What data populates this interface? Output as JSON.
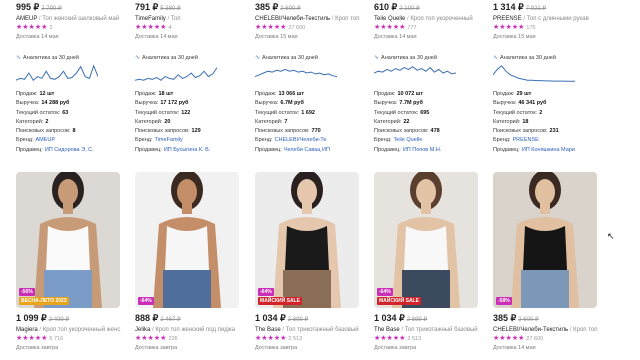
{
  "top_cards": [
    {
      "price": "995 ₽",
      "old_price": "2 790 ₽",
      "brand": "AMEUP",
      "desc": "Топ женский шелковый май",
      "stars": "★★★★★",
      "count": "2",
      "delivery": "Доставка 14 мая",
      "analytics": "Аналитика за 30 дней",
      "spark": [
        0.1,
        0.2,
        0.15,
        0.5,
        0.1,
        0.3,
        0.2,
        0.6,
        0.2,
        0.15,
        0.3,
        0.6,
        0.2,
        0.25,
        0.5,
        0.85,
        0.3,
        0.2,
        0.9,
        0.3
      ],
      "sales": "12 шт",
      "revenue": "14 288 руб",
      "stock": "63",
      "categories": "2",
      "queries": "8",
      "brand_link": "AMEUP",
      "seller": "ИП Сидорова Э. С."
    },
    {
      "price": "791 ₽",
      "old_price": "5 380 ₽",
      "brand": "TimeFamily",
      "desc": "Топ",
      "stars": "★★★★★",
      "count": "4",
      "delivery": "Доставка 14 мая",
      "analytics": "Аналитика за 30 дней",
      "spark": [
        0.1,
        0.15,
        0.1,
        0.2,
        0.15,
        0.25,
        0.1,
        0.3,
        0.2,
        0.15,
        0.4,
        0.2,
        0.3,
        0.5,
        0.25,
        0.35,
        0.6,
        0.3,
        0.45,
        0.8
      ],
      "sales": "18 шт",
      "revenue": "17 172 руб",
      "stock": "122",
      "categories": "20",
      "queries": "129",
      "brand_link": "TimeFamily",
      "seller": "ИП Бусыгина К. В."
    },
    {
      "price": "385 ₽",
      "old_price": "2 600 ₽",
      "brand": "CHELEBI/Челеби-Текстиль",
      "desc": "Кроп топ",
      "stars": "★★★★★",
      "count": "27 600",
      "delivery": "Доставка 15 мая",
      "analytics": "Аналитика за 30 дней",
      "spark": [
        0.3,
        0.4,
        0.5,
        0.6,
        0.55,
        0.65,
        0.6,
        0.7,
        0.6,
        0.65,
        0.55,
        0.6,
        0.5,
        0.55,
        0.45,
        0.5,
        0.4,
        0.45,
        0.35,
        0.3
      ],
      "sales": "13 066 шт",
      "revenue": "6.7M руб",
      "stock": "1 692",
      "categories": "7",
      "queries": "770",
      "brand_link": "CHELEBI/Челеби-Те",
      "seller": "Челеби Савац ИП"
    },
    {
      "price": "610 ₽",
      "old_price": "2 100 ₽",
      "brand": "Teile Quelle",
      "desc": "Кроп топ укороченный",
      "stars": "★★★★★",
      "count": "777",
      "delivery": "Доставка 14 мая",
      "analytics": "Аналитика за 30 дней",
      "spark": [
        0.5,
        0.6,
        0.55,
        0.7,
        0.6,
        0.75,
        0.65,
        0.8,
        0.7,
        0.85,
        0.65,
        0.75,
        0.6,
        0.8,
        0.55,
        0.7,
        0.5,
        0.6,
        0.45,
        0.5
      ],
      "sales": "10 072 шт",
      "revenue": "7.7M руб",
      "stock": "695",
      "categories": "22",
      "queries": "478",
      "brand_link": "Teile Quelle",
      "seller": "ИП Попов М.Н."
    },
    {
      "price": "1 314 ₽",
      "old_price": "7 921 ₽",
      "brand": "PREENSE",
      "desc": "Топ с длинными рукав",
      "stars": "★★★★★",
      "count": "175",
      "delivery": "Доставка 15 мая",
      "analytics": "Аналитика за 30 дней",
      "spark": [
        0.4,
        0.7,
        0.9,
        0.6,
        0.4,
        0.3,
        0.2,
        0.15,
        0.1,
        0.1,
        0.08,
        0.08,
        0.06,
        0.06,
        0.05,
        0.05,
        0.05,
        0.04,
        0.04,
        0.04
      ],
      "sales": "29 шт",
      "revenue": "46 341 руб",
      "stock": "2",
      "categories": "18",
      "queries": "231",
      "brand_link": "PREENSE",
      "seller": "ИП Коняшкина Мари"
    }
  ],
  "labels": {
    "sales": "Продаж:",
    "revenue": "Выручка:",
    "stock": "Текущий остаток:",
    "categories": "Категорий:",
    "queries": "Поисковых запросов:",
    "brand": "Бренд:",
    "seller": "Продавец:"
  },
  "bottom_cards": [
    {
      "badge": "-56%",
      "badge2": "ВЕСНА-ЛЕТО 2023",
      "badge2_color": "#e8a51c",
      "bg": "#dcd8d4",
      "top": "#fafafa",
      "skin": "#c89b78",
      "hair": "#2a2220",
      "bottom": "#7a9cc6",
      "price": "1 099 ₽",
      "old_price": "2 499 ₽",
      "brand": "Magiera",
      "desc": "Кроп топ укороченный женс",
      "stars": "★★★★★",
      "count": "5 716",
      "delivery": "Доставка завтра"
    },
    {
      "badge": "-64%",
      "badge2": "",
      "badge2_color": "",
      "bg": "#f1f1f1",
      "top": "#f7f7f7",
      "skin": "#c38e68",
      "hair": "#3a2a22",
      "bottom": "#4f6f9a",
      "price": "888 ₽",
      "old_price": "2 467 ₽",
      "brand": "Jelika",
      "desc": "Кроп топ женский под пиджа",
      "stars": "★★★★★",
      "count": "226",
      "delivery": "Доставка завтра"
    },
    {
      "badge": "-64%",
      "badge2": "МАЙСКИЙ SALE",
      "badge2_color": "#d2232a",
      "bg": "#ececec",
      "top": "#1a1a1a",
      "skin": "#e5c7ae",
      "hair": "#2a2020",
      "bottom": "#8a6e55",
      "price": "1 034 ₽",
      "old_price": "2 899 ₽",
      "brand": "The Base",
      "desc": "Топ трикотажный базовый",
      "stars": "★★★★★",
      "count": "2 513",
      "delivery": "Доставка завтра"
    },
    {
      "badge": "-64%",
      "badge2": "МАЙСКИЙ SALE",
      "badge2_color": "#d2232a",
      "bg": "#e6e2dd",
      "top": "#f8f8f8",
      "skin": "#e2c3a6",
      "hair": "#5a3e2e",
      "bottom": "#3c4a5f",
      "price": "1 034 ₽",
      "old_price": "2 899 ₽",
      "brand": "The Base",
      "desc": "Топ трикотажный базовый",
      "stars": "★★★★★",
      "count": "2 513",
      "delivery": "Доставка завтра"
    },
    {
      "badge": "-58%",
      "badge2": "",
      "badge2_color": "",
      "bg": "#d9d3cc",
      "top": "#151515",
      "skin": "#e0c0a0",
      "hair": "#3a2a22",
      "bottom": "#7d97b8",
      "price": "385 ₽",
      "old_price": "2 600 ₽",
      "brand": "CHELEBI/Челеби-Текстиль",
      "desc": "Кроп топ",
      "stars": "★★★★★",
      "count": "27 600",
      "delivery": "Доставка 14 мая"
    }
  ]
}
